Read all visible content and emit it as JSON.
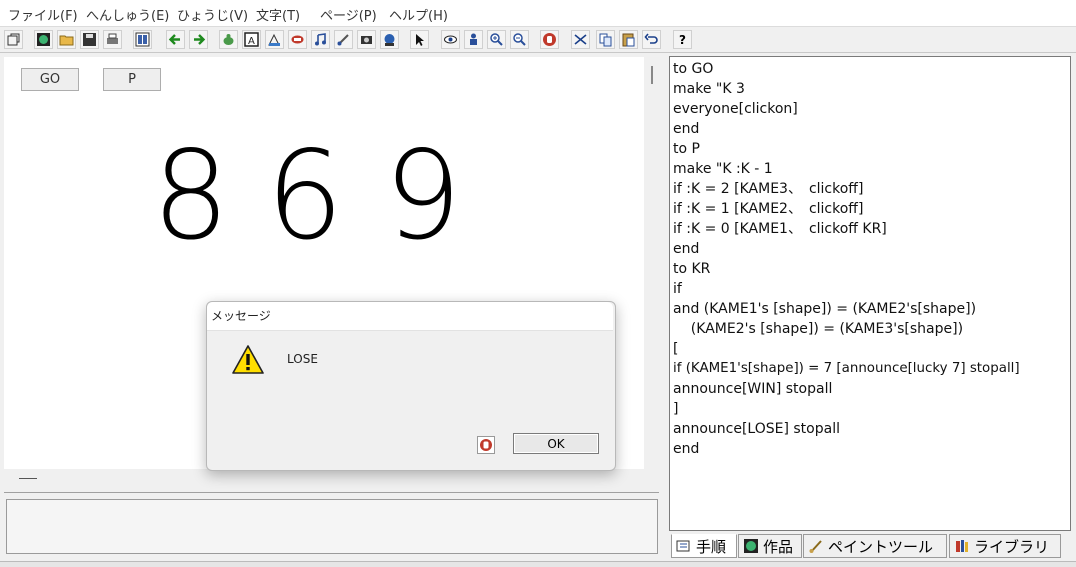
{
  "menu": [
    "ファイル(F)",
    "へんしゅう(E)",
    "ひょうじ(V)",
    "文字(T)",
    "ページ(P)",
    "ヘルプ(H)"
  ],
  "toolbar": {
    "help_label": "?",
    "icons": [
      "restore-icon",
      "world-icon",
      "open-folder-icon",
      "save-icon",
      "print-icon",
      "page-layout-icon",
      "back-arrow-icon",
      "forward-arrow-icon",
      "turtle-icon",
      "text-box-icon",
      "paint-icon",
      "stamp-icon",
      "music-note-icon",
      "brush-icon",
      "camera-icon",
      "globe-icon",
      "pointer-icon",
      "eye-icon",
      "person-icon",
      "zoom-in-icon",
      "zoom-out-icon",
      "stop-hand-icon",
      "cut-icon",
      "copy-icon",
      "paste-icon",
      "undo-icon",
      "help-icon"
    ]
  },
  "canvas": {
    "buttons": [
      {
        "label": "GO"
      },
      {
        "label": "P"
      }
    ],
    "digits": [
      "8",
      "6",
      "9"
    ]
  },
  "editor": {
    "lines": [
      "to GO",
      "make \"K 3",
      "everyone[clickon]",
      "end",
      "to P",
      "make \"K :K - 1",
      "if :K = 2 [KAME3、　clickoff]",
      "if :K = 1 [KAME2、　clickoff]",
      "if :K = 0 [KAME1、　clickoff KR]",
      "end",
      "to KR",
      "if",
      "and (KAME1's [shape]) = (KAME2's[shape])",
      "    (KAME2's [shape]) = (KAME3's[shape])",
      "[",
      "if (KAME1's[shape]) = 7 [announce[lucky 7] stopall]",
      "announce[WIN] stopall",
      "]",
      "announce[LOSE] stopall",
      "end"
    ]
  },
  "tabs": [
    {
      "label": "手順",
      "icon": "procedure-icon"
    },
    {
      "label": "作品",
      "icon": "world-icon"
    },
    {
      "label": "ペイントツール",
      "icon": "paintbrush-icon"
    },
    {
      "label": "ライブラリ",
      "icon": "library-icon"
    }
  ],
  "dialog": {
    "title": "メッセージ",
    "message": "LOSE",
    "ok_label": "OK",
    "icon": "warning-icon"
  },
  "colors": {
    "warning": "#ffde00",
    "stop_red": "#c0392b",
    "world_green": "#2e8b57"
  }
}
